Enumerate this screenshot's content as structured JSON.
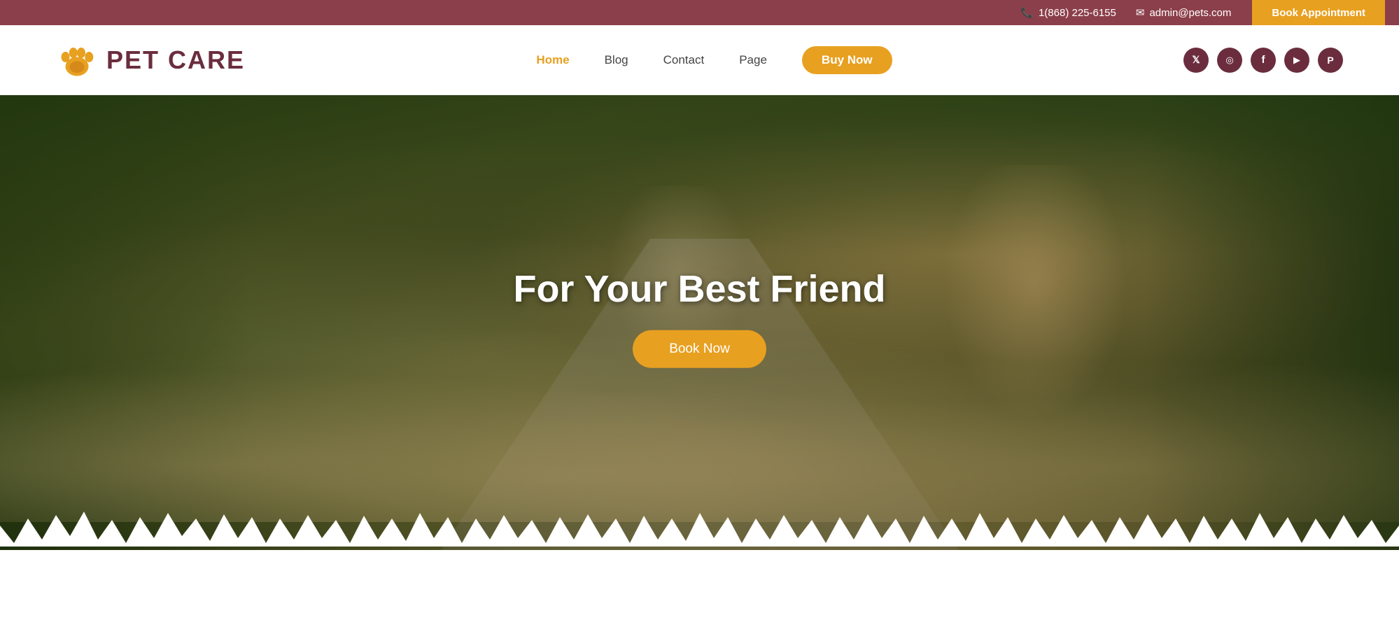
{
  "topbar": {
    "phone": "1(868) 225-6155",
    "email": "admin@pets.com",
    "book_btn": "Book Appointment"
  },
  "navbar": {
    "logo_text": "PET CARE",
    "nav_items": [
      {
        "label": "Home",
        "active": true
      },
      {
        "label": "Blog",
        "active": false
      },
      {
        "label": "Contact",
        "active": false
      },
      {
        "label": "Page",
        "active": false
      }
    ],
    "buy_btn": "Buy Now",
    "social": [
      {
        "icon": "twitter",
        "symbol": "𝕏"
      },
      {
        "icon": "instagram",
        "symbol": "📷"
      },
      {
        "icon": "facebook",
        "symbol": "f"
      },
      {
        "icon": "youtube",
        "symbol": "▶"
      },
      {
        "icon": "pinterest",
        "symbol": "P"
      }
    ]
  },
  "hero": {
    "title": "For Your Best Friend",
    "book_btn": "Book Now"
  },
  "colors": {
    "maroon": "#8b3f4a",
    "orange": "#e8a020",
    "dark_brown": "#6b2d3e"
  }
}
